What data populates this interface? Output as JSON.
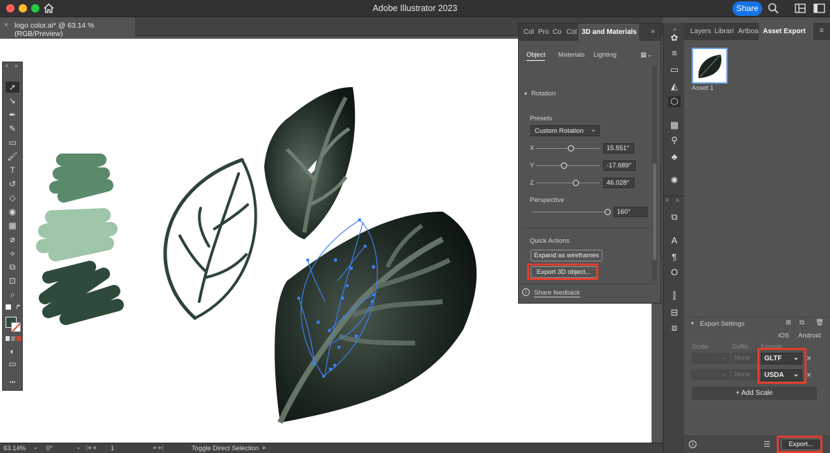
{
  "app": {
    "title": "Adobe Illustrator 2023",
    "share_label": "Share"
  },
  "doc_tab": {
    "title": "logo color.ai* @ 63.14 % (RGB/Preview)",
    "close": "×"
  },
  "toolbar": {
    "collapse": "×",
    "expand": "»",
    "more": "•••"
  },
  "panel_3d": {
    "tabs": [
      "Col",
      "Pro",
      "Co",
      "Col",
      "3D and Materials"
    ],
    "expand": "»",
    "subtabs": [
      "Object",
      "Materials",
      "Lighting"
    ],
    "section": "Rotation",
    "presets_label": "Presets",
    "preset_value": "Custom Rotation",
    "x_label": "X",
    "x_value": "15.551°",
    "x_level": 0.55,
    "y_label": "Y",
    "y_value": "-17.689°",
    "y_level": 0.45,
    "z_label": "Z",
    "z_value": "46.028°",
    "z_level": 0.63,
    "perspective_label": "Perspective",
    "perspective_value": "160°",
    "perspective_level": 1.0,
    "quick_actions_label": "Quick Actions",
    "expand_wireframes": "Expand as wireframes",
    "export_3d": "Export 3D object...",
    "share_feedback": "Share feedback"
  },
  "panel_asset": {
    "tabs": [
      "Layers",
      "Librari",
      "Artboa",
      "Asset Export"
    ],
    "asset_name": "Asset 1",
    "export_settings": "Export Settings",
    "ios": "iOS",
    "android": "Android",
    "col_scale": "Scale",
    "col_suffix": "Suffix",
    "col_format": "Format",
    "rows": [
      {
        "suffix": "None",
        "format": "GLTF"
      },
      {
        "suffix": "None",
        "format": "USDA"
      }
    ],
    "add_scale": "+ Add Scale",
    "export_btn": "Export..."
  },
  "status": {
    "zoom": "63.14%",
    "rotation": "0°",
    "artboard": "1",
    "tool_hint": "Toggle Direct Selection"
  },
  "colors": {
    "accent": "#1473e6",
    "highlight": "#e33d2b",
    "selection": "#3f7ff5",
    "leaf_dark": "#1e2b24",
    "leaf_outline": "#2e4337"
  }
}
